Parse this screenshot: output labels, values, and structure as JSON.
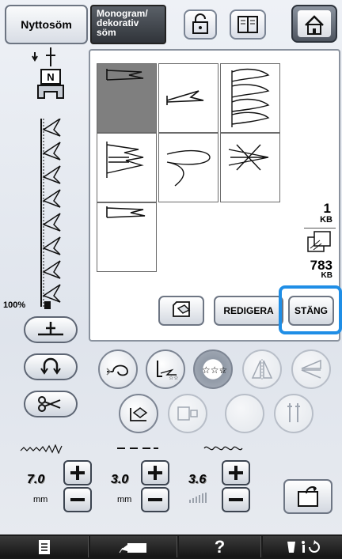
{
  "tabs": {
    "utility": "Nyttosöm",
    "monogram_line1": "Monogram/",
    "monogram_line2": "dekorativ",
    "monogram_line3": "söm"
  },
  "memory": {
    "kb_used": "1",
    "kb_unit": "KB",
    "kb_free": "783",
    "kb_unit2": "KB"
  },
  "zoom": "100%",
  "panel_buttons": {
    "edit": "REDIGERA",
    "close": "STÄNG"
  },
  "settings": {
    "width_value": "7.0",
    "width_unit": "mm",
    "length_value": "3.0",
    "length_unit": "mm",
    "tension_value": "3.6"
  },
  "colors": {
    "highlight": "#1f8ee6",
    "tab_active": "#e8ebf0",
    "tab_inactive": "#4a4f58"
  }
}
